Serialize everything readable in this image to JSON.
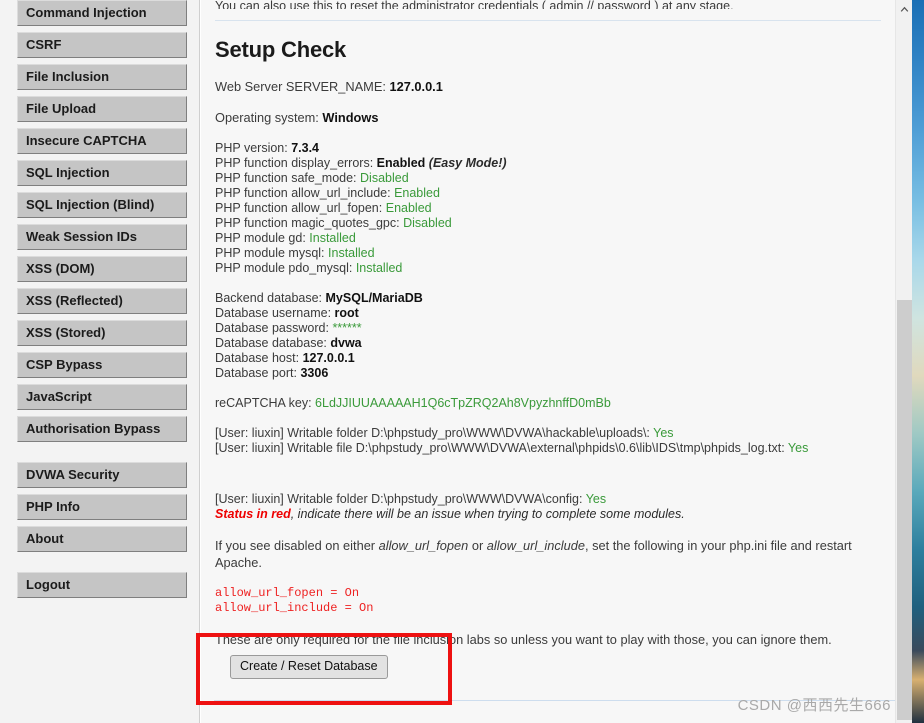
{
  "sidebar": {
    "groups": [
      {
        "items": [
          {
            "label": "Command Injection"
          },
          {
            "label": "CSRF"
          },
          {
            "label": "File Inclusion"
          },
          {
            "label": "File Upload"
          },
          {
            "label": "Insecure CAPTCHA"
          },
          {
            "label": "SQL Injection"
          },
          {
            "label": "SQL Injection (Blind)"
          },
          {
            "label": "Weak Session IDs"
          },
          {
            "label": "XSS (DOM)"
          },
          {
            "label": "XSS (Reflected)"
          },
          {
            "label": "XSS (Stored)"
          },
          {
            "label": "CSP Bypass"
          },
          {
            "label": "JavaScript"
          },
          {
            "label": "Authorisation Bypass"
          }
        ]
      },
      {
        "items": [
          {
            "label": "DVWA Security"
          },
          {
            "label": "PHP Info"
          },
          {
            "label": "About"
          }
        ]
      },
      {
        "items": [
          {
            "label": "Logout"
          }
        ]
      }
    ]
  },
  "main": {
    "cut_line": "You can also use this to reset the administrator credentials ( admin // password ) at any stage.",
    "title": "Setup Check",
    "web_server_label": "Web Server SERVER_NAME:",
    "web_server_value": "127.0.0.1",
    "os_label": "Operating system:",
    "os_value": "Windows",
    "php_rows": [
      {
        "label": "PHP version:",
        "value": "7.3.4",
        "style": "bold",
        "note": ""
      },
      {
        "label": "PHP function display_errors:",
        "value": "Enabled",
        "style": "bold",
        "note": "(Easy Mode!)"
      },
      {
        "label": "PHP function safe_mode:",
        "value": "Disabled",
        "style": "ok",
        "note": ""
      },
      {
        "label": "PHP function allow_url_include:",
        "value": "Enabled",
        "style": "ok",
        "note": ""
      },
      {
        "label": "PHP function allow_url_fopen:",
        "value": "Enabled",
        "style": "ok",
        "note": ""
      },
      {
        "label": "PHP function magic_quotes_gpc:",
        "value": "Disabled",
        "style": "ok",
        "note": ""
      },
      {
        "label": "PHP module gd:",
        "value": "Installed",
        "style": "ok",
        "note": ""
      },
      {
        "label": "PHP module mysql:",
        "value": "Installed",
        "style": "ok",
        "note": ""
      },
      {
        "label": "PHP module pdo_mysql:",
        "value": "Installed",
        "style": "ok",
        "note": ""
      }
    ],
    "db_rows": [
      {
        "label": "Backend database:",
        "value": "MySQL/MariaDB",
        "style": "bold"
      },
      {
        "label": "Database username:",
        "value": "root",
        "style": "bold"
      },
      {
        "label": "Database password:",
        "value": "******",
        "style": "ok"
      },
      {
        "label": "Database database:",
        "value": "dvwa",
        "style": "bold"
      },
      {
        "label": "Database host:",
        "value": "127.0.0.1",
        "style": "bold"
      },
      {
        "label": "Database port:",
        "value": "3306",
        "style": "bold"
      }
    ],
    "recaptcha_label": "reCAPTCHA key:",
    "recaptcha_value": "6LdJJIUUAAAAAH1Q6cTpZRQ2Ah8VpyzhnffD0mBb",
    "writable_rows": [
      {
        "label": "[User: liuxin] Writable folder D:\\phpstudy_pro\\WWW\\DVWA\\hackable\\uploads\\:",
        "value": "Yes"
      },
      {
        "label": "[User: liuxin] Writable file D:\\phpstudy_pro\\WWW\\DVWA\\external\\phpids\\0.6\\lib\\IDS\\tmp\\phpids_log.txt:",
        "value": "Yes"
      }
    ],
    "config_row": {
      "label": "[User: liuxin] Writable folder D:\\phpstudy_pro\\WWW\\DVWA\\config:",
      "value": "Yes"
    },
    "status_warning_red": "Status in red",
    "status_warning_rest": ", indicate there will be an issue when trying to complete some modules.",
    "disabled_para_1": "If you see disabled on either ",
    "disabled_em_1": "allow_url_fopen",
    "disabled_para_2": " or ",
    "disabled_em_2": "allow_url_include",
    "disabled_para_3": ", set the following in your php.ini file and restart Apache.",
    "code_lines": [
      "allow_url_fopen = On",
      "allow_url_include = On"
    ],
    "closing_para": "These are only required for the file inclusion labs so unless you want to play with those, you can ignore them.",
    "reset_button_label": "Create / Reset Database"
  },
  "watermark": "CSDN @西西先生666",
  "colors": {
    "ok_green": "#3a9a3a",
    "alert_red": "#ee2222",
    "highlight_red": "#ee1111",
    "nav_button": "#c5c5c5"
  }
}
